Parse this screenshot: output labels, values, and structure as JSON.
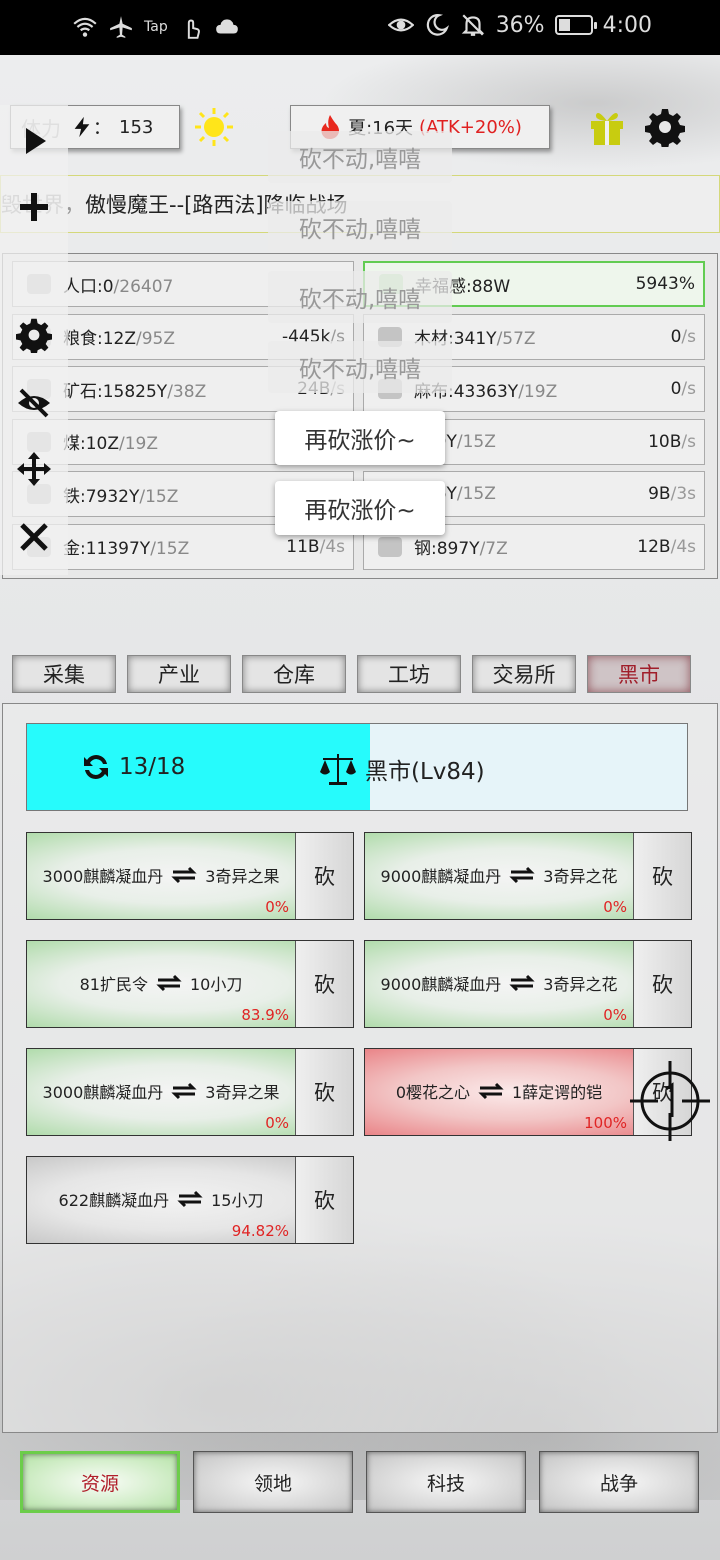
{
  "status_bar": {
    "left_label": "Tap",
    "battery": "36%",
    "time": "4:00"
  },
  "header": {
    "stamina_label": "体力",
    "stamina_sep": "：",
    "stamina_value": "153",
    "season_text": "夏:16天",
    "season_bonus": "(ATK+20%)"
  },
  "marquee": {
    "prefix": "毁世界，",
    "text": "傲慢魔王--[路西法]降临战场"
  },
  "resources": [
    {
      "name": "人口:0",
      "max": "/26407",
      "rate": "",
      "unit": "",
      "icon": "people-icon"
    },
    {
      "name": "幸福感:88W",
      "max": "",
      "rate": "5943%",
      "unit": "",
      "icon": "smile-icon",
      "highlight": true
    },
    {
      "name": "粮食:12Z",
      "max": "/95Z",
      "rate": "-445k",
      "unit": "/s",
      "icon": "grain-icon"
    },
    {
      "name": "木材:341Y",
      "max": "/57Z",
      "rate": "0",
      "unit": "/s",
      "icon": "wood-icon"
    },
    {
      "name": "矿石:15825Y",
      "max": "/38Z",
      "rate": "24B",
      "unit": "/s",
      "icon": "ore-icon"
    },
    {
      "name": "麻布:43363Y",
      "max": "/19Z",
      "rate": "0",
      "unit": "/s",
      "icon": "cloth-icon"
    },
    {
      "name": "煤:10Z",
      "max": "/19Z",
      "rate": "",
      "unit": "",
      "icon": "coal-icon"
    },
    {
      "name": "649Y",
      "max": "/15Z",
      "rate": "10B",
      "unit": "/s",
      "icon": "stone-icon"
    },
    {
      "name": "铁:7932Y",
      "max": "/15Z",
      "rate": "",
      "unit": "",
      "icon": "iron-icon"
    },
    {
      "name": "356Y",
      "max": "/15Z",
      "rate": "9B",
      "unit": "/3s",
      "icon": "brick-icon"
    },
    {
      "name": "金:11397Y",
      "max": "/15Z",
      "rate": "11B",
      "unit": "/4s",
      "icon": "gold-icon"
    },
    {
      "name": "钢:897Y",
      "max": "/7Z",
      "rate": "12B",
      "unit": "/4s",
      "icon": "steel-icon"
    }
  ],
  "ghost_texts": [
    "砍不动,嘻嘻",
    "砍不动,嘻嘻",
    "砍不动,嘻嘻",
    "砍不动,嘻嘻"
  ],
  "popups": [
    "再砍涨价~",
    "再砍涨价~"
  ],
  "tabs": [
    "采集",
    "产业",
    "仓库",
    "工坊",
    "交易所",
    "黑市"
  ],
  "active_tab": "黑市",
  "market": {
    "refresh_count": "13/18",
    "refresh_progress": 0.52,
    "title": "黑市(Lv84)"
  },
  "trades": [
    {
      "give": "3000麒麟凝血丹",
      "get": "3奇异之果",
      "pct": "0%",
      "cut": "砍",
      "style": "green"
    },
    {
      "give": "9000麒麟凝血丹",
      "get": "3奇异之花",
      "pct": "0%",
      "cut": "砍",
      "style": "green"
    },
    {
      "give": "81扩民令",
      "get": "10小刀",
      "pct": "83.9%",
      "cut": "砍",
      "style": "green"
    },
    {
      "give": "9000麒麟凝血丹",
      "get": "3奇异之花",
      "pct": "0%",
      "cut": "砍",
      "style": "green"
    },
    {
      "give": "3000麒麟凝血丹",
      "get": "3奇异之果",
      "pct": "0%",
      "cut": "砍",
      "style": "green"
    },
    {
      "give": "0樱花之心",
      "get": "1薛定谔的铠",
      "pct": "100%",
      "cut": "砍",
      "style": "red"
    },
    {
      "give": "622麒麟凝血丹",
      "get": "15小刀",
      "pct": "94.82%",
      "cut": "砍",
      "style": "gray"
    }
  ],
  "bottom_nav": [
    "资源",
    "领地",
    "科技",
    "战争"
  ],
  "active_nav": "资源"
}
